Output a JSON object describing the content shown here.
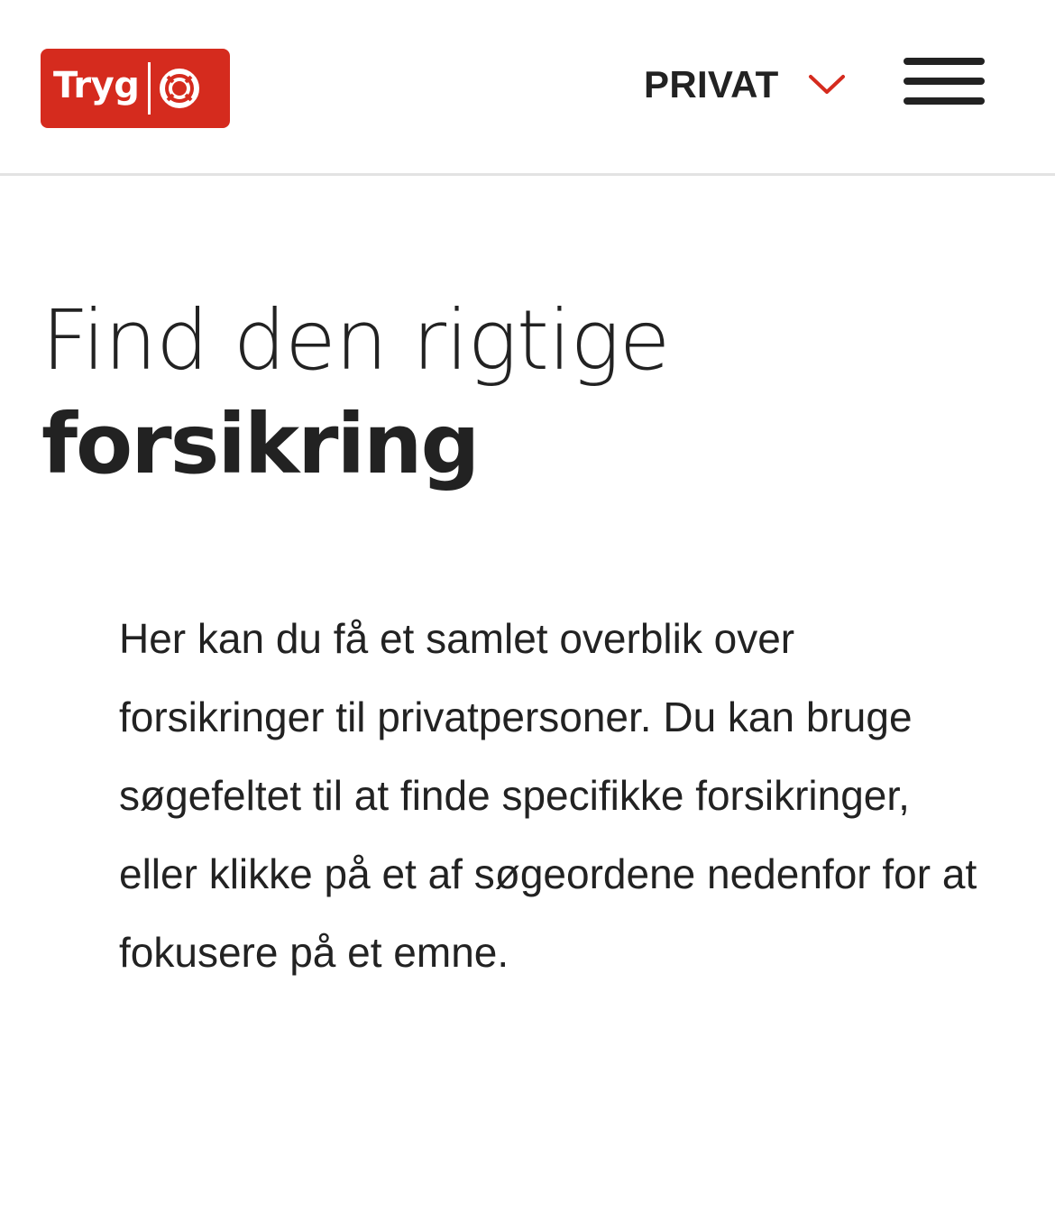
{
  "header": {
    "logo_text": "Tryg",
    "logo_icon": "lifebuoy-icon",
    "segment_label": "PRIVAT",
    "segment_icon": "chevron-down-icon",
    "menu_icon": "hamburger-menu-icon"
  },
  "main": {
    "headline_line1": "Find den rigtige",
    "headline_line2": "forsikring",
    "intro": "Her kan du få et samlet overblik over forsikringer til privatpersoner. Du kan bruge søgefeltet til at finde specifikke forsikringer, eller klikke på et af søgeordene nedenfor for at fokusere på et emne."
  },
  "colors": {
    "brand_red": "#d52b1e",
    "text": "#222222",
    "divider": "#e3e3e3",
    "background": "#ffffff"
  }
}
